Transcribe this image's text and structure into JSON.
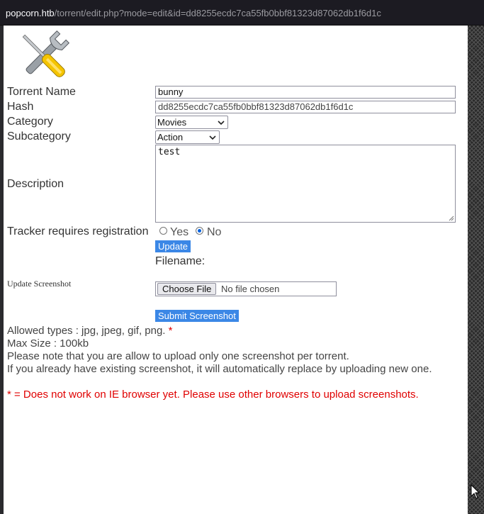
{
  "browser": {
    "url_host": "popcorn.htb",
    "url_path": "/torrent/edit.php?mode=edit&id=dd8255ecdc7ca55fb0bbf81323d87062db1f6d1c"
  },
  "form": {
    "torrent_name_label": "Torrent Name",
    "torrent_name_value": "bunny",
    "hash_label": "Hash",
    "hash_value": "dd8255ecdc7ca55fb0bbf81323d87062db1f6d1c",
    "category_label": "Category",
    "category_value": "Movies",
    "subcategory_label": "Subcategory",
    "subcategory_value": "Action",
    "description_label": "Description",
    "description_value": "test",
    "tracker_label": "Tracker requires registration",
    "tracker_yes": "Yes",
    "tracker_no": "No",
    "tracker_selected": "No",
    "update_button": "Update"
  },
  "screenshot": {
    "filename_label": "Filename:",
    "update_label": "Update Screenshot",
    "choose_file": "Choose File",
    "no_file": "No file chosen",
    "submit_button": "Submit Screenshot"
  },
  "notes": {
    "allowed_types": "Allowed types : jpg, jpeg, gif, png.",
    "asterisk": "*",
    "max_size": "Max Size : 100kb",
    "one_screenshot": "Please note that you are allow to upload only one screenshot per torrent.",
    "replace_note": "If you already have existing screenshot, it will automatically replace by uploading new one.",
    "ie_warning": "* = Does not work on IE browser yet. Please use other browsers to upload screenshots."
  },
  "colors": {
    "button_blue": "#3b87e6",
    "warning_red": "#e00000",
    "tool_yellow": "#f5c400"
  }
}
